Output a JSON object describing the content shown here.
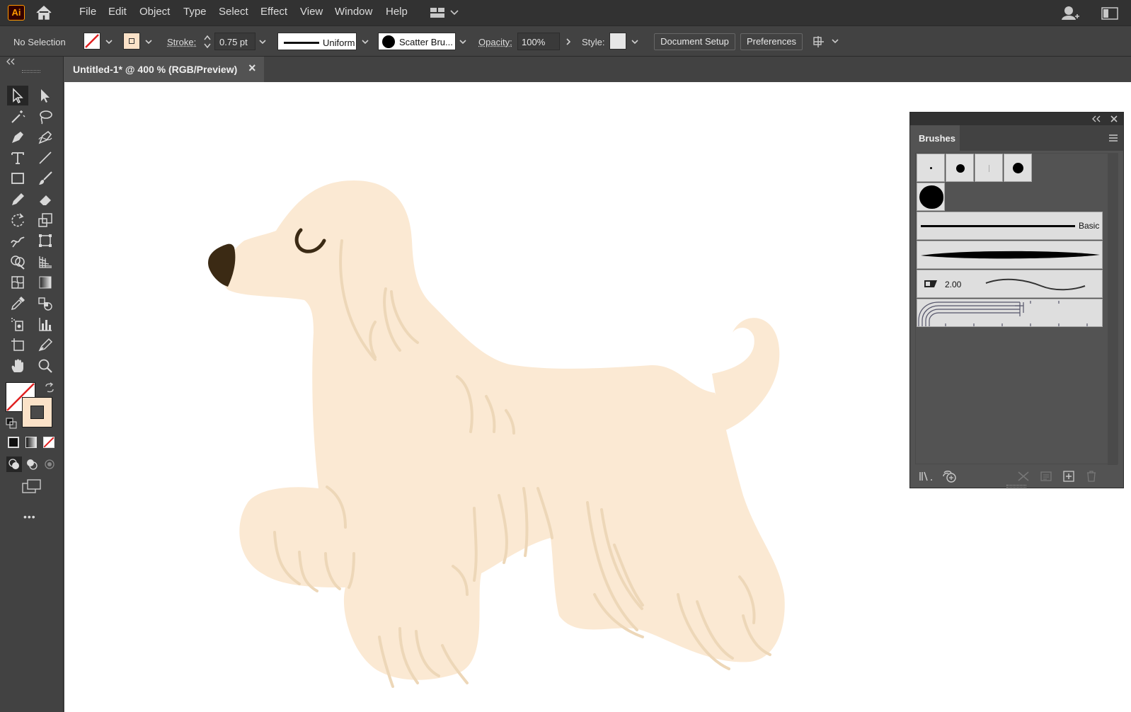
{
  "app": {
    "logo_text": "Ai",
    "menus": [
      "File",
      "Edit",
      "Object",
      "Type",
      "Select",
      "Effect",
      "View",
      "Window",
      "Help"
    ]
  },
  "control": {
    "selection_state": "No Selection",
    "stroke_label": "Stroke:",
    "stroke_value": "0.75 pt",
    "profile_label": "Uniform",
    "brush_label": "Scatter Bru...",
    "opacity_label": "Opacity:",
    "opacity_value": "100%",
    "style_label": "Style:",
    "doc_setup_label": "Document Setup",
    "preferences_label": "Preferences"
  },
  "document": {
    "tab_title": "Untitled-1* @ 400 % (RGB/Preview)",
    "close_glyph": "×"
  },
  "toolbar": {
    "more_glyph": "•••"
  },
  "brushes": {
    "panel_title": "Brushes",
    "basic_label": "Basic",
    "art_brush_size": "2.00"
  },
  "colors": {
    "fill": "#FBE9D3",
    "nose": "#3B2A14",
    "accent_red": "#E02020",
    "fur_line": "#EDD7B8"
  }
}
